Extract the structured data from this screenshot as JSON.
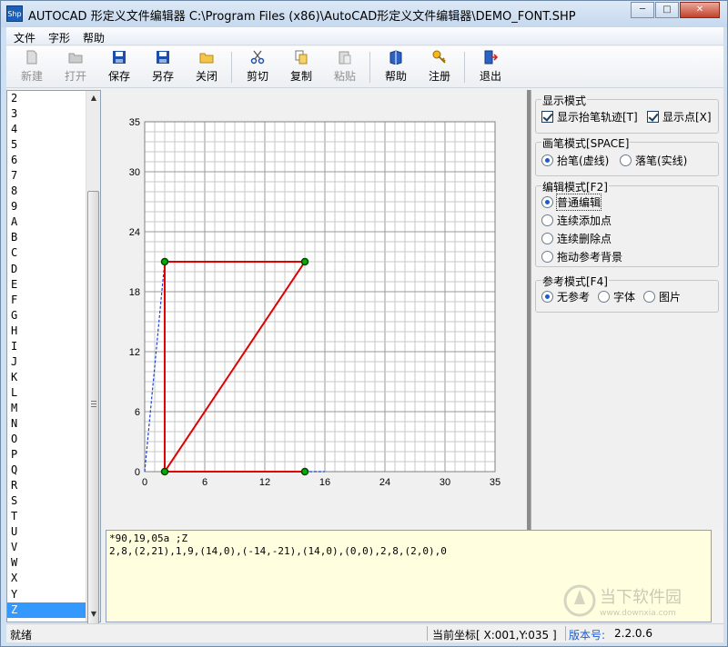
{
  "window": {
    "app_icon_text": "Shp",
    "title": "AUTOCAD 形定义文件编辑器 C:\\Program Files (x86)\\AutoCAD形定义文件编辑器\\DEMO_FONT.SHP"
  },
  "menu": [
    "文件",
    "字形",
    "帮助"
  ],
  "toolbar": {
    "new": "新建",
    "open": "打开",
    "save": "保存",
    "save_as": "另存",
    "close": "关闭",
    "cut": "剪切",
    "copy": "复制",
    "paste": "粘贴",
    "help": "帮助",
    "register": "注册",
    "exit": "退出"
  },
  "glyph_list": {
    "items": [
      "2",
      "3",
      "4",
      "5",
      "6",
      "7",
      "8",
      "9",
      "A",
      "B",
      "C",
      "D",
      "E",
      "F",
      "G",
      "H",
      "I",
      "J",
      "K",
      "L",
      "M",
      "N",
      "O",
      "P",
      "Q",
      "R",
      "S",
      "T",
      "U",
      "V",
      "W",
      "X",
      "Y",
      "Z"
    ],
    "selected": "Z"
  },
  "chart_data": {
    "type": "scatter",
    "xlim": [
      0,
      35
    ],
    "ylim": [
      0,
      35
    ],
    "xticks": [
      0,
      6,
      12,
      18,
      24,
      30,
      35
    ],
    "yticks": [
      0,
      6,
      12,
      18,
      24,
      30,
      35
    ],
    "x_tick_labels": [
      "0",
      "6",
      "12",
      "16",
      "24",
      "30",
      "35"
    ],
    "y_tick_labels": [
      "0",
      "6",
      "12",
      "18",
      "24",
      "30",
      "35"
    ],
    "grid": true,
    "pen_down_path": [
      [
        2,
        0
      ],
      [
        2,
        21
      ],
      [
        16,
        21
      ],
      [
        2,
        0
      ],
      [
        16,
        0
      ]
    ],
    "pen_up_path": [
      [
        0,
        0
      ],
      [
        2,
        21
      ]
    ],
    "pen_up_tail": [
      [
        16,
        0
      ],
      [
        18,
        0
      ]
    ],
    "points": [
      [
        2,
        21
      ],
      [
        16,
        21
      ],
      [
        2,
        0
      ],
      [
        16,
        0
      ]
    ],
    "colors": {
      "pen_down": "#e00000",
      "pen_up": "#1b3fd8",
      "point_fill": "#00b000",
      "point_stroke": "#004400"
    }
  },
  "display_mode": {
    "title": "显示模式",
    "show_pen_up_trace": {
      "label": "显示抬笔轨迹[T]",
      "checked": true
    },
    "show_points": {
      "label": "显示点[X]",
      "checked": true
    }
  },
  "pen_mode": {
    "title": "画笔模式[SPACE]",
    "options": [
      {
        "label": "抬笔(虚线)",
        "checked": true
      },
      {
        "label": "落笔(实线)",
        "checked": false
      }
    ]
  },
  "edit_mode": {
    "title": "编辑模式[F2]",
    "options": [
      {
        "label": "普通编辑",
        "checked": true
      },
      {
        "label": "连续添加点",
        "checked": false
      },
      {
        "label": "连续删除点",
        "checked": false
      },
      {
        "label": "拖动参考背景",
        "checked": false
      }
    ]
  },
  "ref_mode": {
    "title": "参考模式[F4]",
    "options": [
      {
        "label": "无参考",
        "checked": true
      },
      {
        "label": "字体",
        "checked": false
      },
      {
        "label": "图片",
        "checked": false
      }
    ]
  },
  "editor": {
    "line1": "*90,19,05a ;Z",
    "line2": "2,8,(2,21),1,9,(14,0),(-14,-21),(14,0),(0,0),2,8,(2,0),0"
  },
  "status": {
    "ready": "就绪",
    "coordinate": "当前坐标[ X:001,Y:035 ]",
    "version_label": "版本号:",
    "version": "2.2.0.6"
  },
  "watermark": {
    "text": "当下软件园",
    "url_text": "www.downxia.com"
  }
}
